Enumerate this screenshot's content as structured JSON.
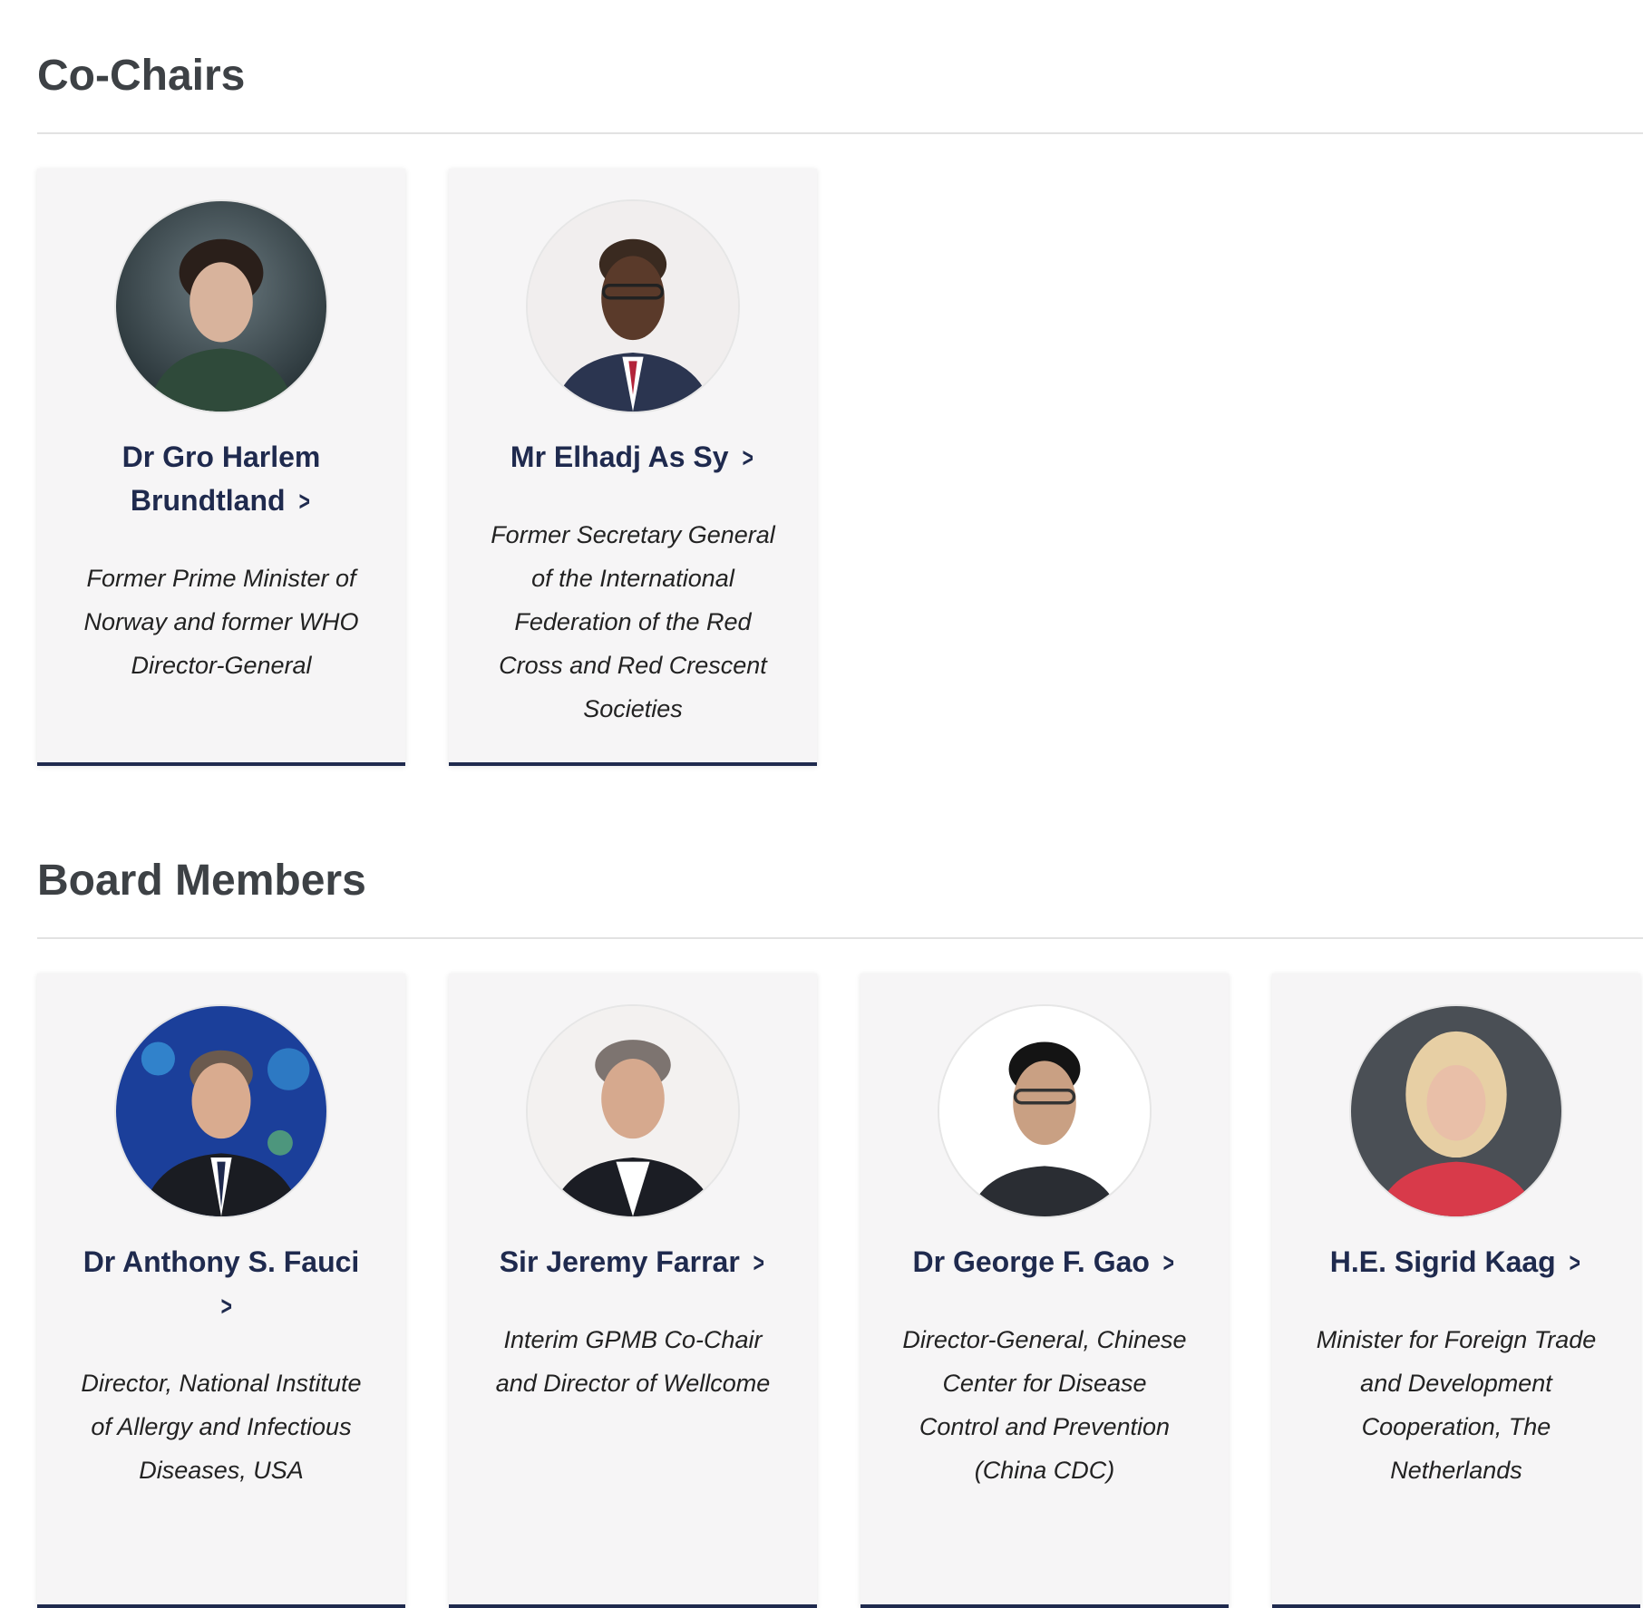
{
  "sections": [
    {
      "title": "Co-Chairs",
      "members": [
        {
          "name": "Dr Gro Harlem Brundtland",
          "role": "Former Prime Minister of Norway and former WHO Director-General",
          "photo": "portrait-photo"
        },
        {
          "name": "Mr Elhadj As Sy",
          "role": "Former Secretary General of the International Federation of the Red Cross and Red Crescent Societies",
          "photo": "portrait-photo"
        }
      ]
    },
    {
      "title": "Board Members",
      "members": [
        {
          "name": "Dr Anthony S. Fauci",
          "role": "Director, National Institute of Allergy and Infectious Diseases, USA",
          "photo": "portrait-photo"
        },
        {
          "name": "Sir Jeremy Farrar",
          "role": "Interim GPMB Co-Chair and Director of Wellcome",
          "photo": "portrait-photo"
        },
        {
          "name": "Dr George F. Gao",
          "role": "Director-General, Chinese Center for Disease Control and Prevention (China CDC)",
          "photo": "portrait-photo"
        },
        {
          "name": "H.E. Sigrid Kaag",
          "role": "Minister for Foreign Trade and Development Cooperation, The Netherlands",
          "photo": "portrait-photo"
        }
      ]
    }
  ],
  "icons": {
    "chevron": "chevron-right-icon"
  },
  "colors": {
    "heading": "#3d4145",
    "link": "#1f2a4e",
    "card_bg": "#f6f5f6",
    "card_border": "#1f2a4e"
  }
}
